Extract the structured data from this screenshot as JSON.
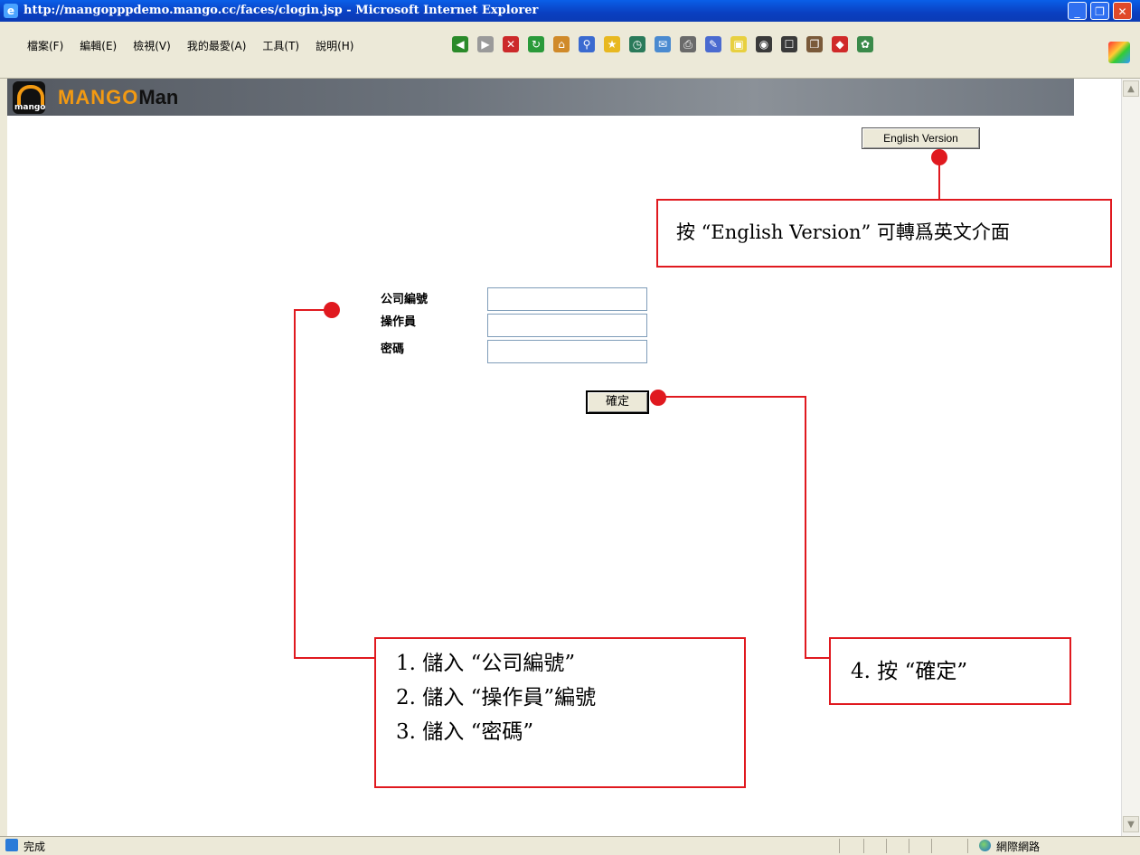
{
  "window": {
    "title": "http://mangopppdemo.mango.cc/faces/clogin.jsp - Microsoft Internet Explorer",
    "minimize_label": "_",
    "maximize_label": "❐",
    "close_label": "✕"
  },
  "menu": {
    "items": [
      "檔案(F)",
      "編輯(E)",
      "檢視(V)",
      "我的最愛(A)",
      "工具(T)",
      "說明(H)"
    ]
  },
  "toolbar": {
    "icons": [
      "back-icon",
      "forward-icon",
      "stop-icon",
      "refresh-icon",
      "home-icon",
      "search-icon",
      "favorites-icon",
      "history-icon",
      "mail-icon",
      "print-icon",
      "edit-icon",
      "discuss-icon",
      "messenger-icon",
      "research-icon",
      "bookmark-icon",
      "pdf-icon",
      "extra-icon"
    ],
    "colors": [
      "#2a8a2a",
      "#9a9a9a",
      "#cc2a2a",
      "#2a9a3a",
      "#d08a2a",
      "#3a6ad0",
      "#e8b820",
      "#2a7a5a",
      "#4a8ad0",
      "#6a6a6a",
      "#4a6ad0",
      "#e8d040",
      "#3a3a3a",
      "#3a3a3a",
      "#7a5a3a",
      "#d02a2a",
      "#3a8a4a"
    ]
  },
  "banner": {
    "logo_text": "mango",
    "brand_mango": "MANGO",
    "brand_man": "Man"
  },
  "page": {
    "english_button": "English Version",
    "form": {
      "company_label": "公司編號",
      "operator_label": "操作員",
      "password_label": "密碼",
      "company_value": "",
      "operator_value": "",
      "password_value": ""
    },
    "ok_button": "確定"
  },
  "callouts": {
    "english": "按 “English Version” 可轉爲英文介面",
    "steps": [
      "1.  儲入 “公司編號”",
      "2.  儲入 “操作員”編號",
      "3.  儲入 “密碼”"
    ],
    "step4": "4.  按 “確定”"
  },
  "status": {
    "text": "完成",
    "zone": "網際網路"
  },
  "colors": {
    "callout": "#e0191f",
    "accent": "#f39a12"
  }
}
